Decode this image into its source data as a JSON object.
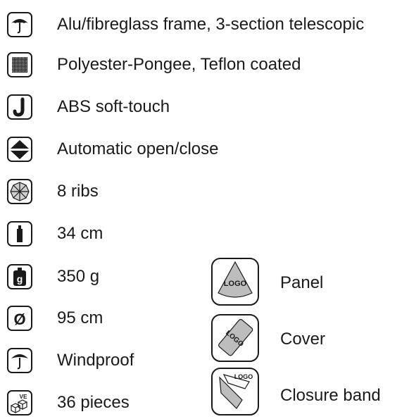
{
  "specs": [
    {
      "icon": "umbrella-frame-icon",
      "text": "Alu/fibreglass frame, 3-section telescopic"
    },
    {
      "icon": "fabric-pattern-icon",
      "text": "Polyester-Pongee, Teflon coated"
    },
    {
      "icon": "handle-j-icon",
      "text": "ABS soft-touch"
    },
    {
      "icon": "auto-open-close-icon",
      "text": "Automatic open/close"
    },
    {
      "icon": "ribs-icon",
      "text": "8 ribs"
    },
    {
      "icon": "length-icon",
      "text": "34 cm"
    },
    {
      "icon": "weight-icon",
      "text": "350 g"
    },
    {
      "icon": "diameter-icon",
      "text": "95 cm"
    },
    {
      "icon": "windproof-icon",
      "text": "Windproof"
    },
    {
      "icon": "packing-unit-icon",
      "text": "36 pieces"
    }
  ],
  "branding": [
    {
      "icon": "panel-logo-icon",
      "text": "Panel"
    },
    {
      "icon": "cover-logo-icon",
      "text": "Cover"
    },
    {
      "icon": "closure-band-logo-icon",
      "text": "Closure band"
    }
  ],
  "icon_text": {
    "weight_glyph": "g",
    "diameter_glyph": "Ø",
    "packing_glyph": "VE",
    "logo": "LOGO"
  }
}
